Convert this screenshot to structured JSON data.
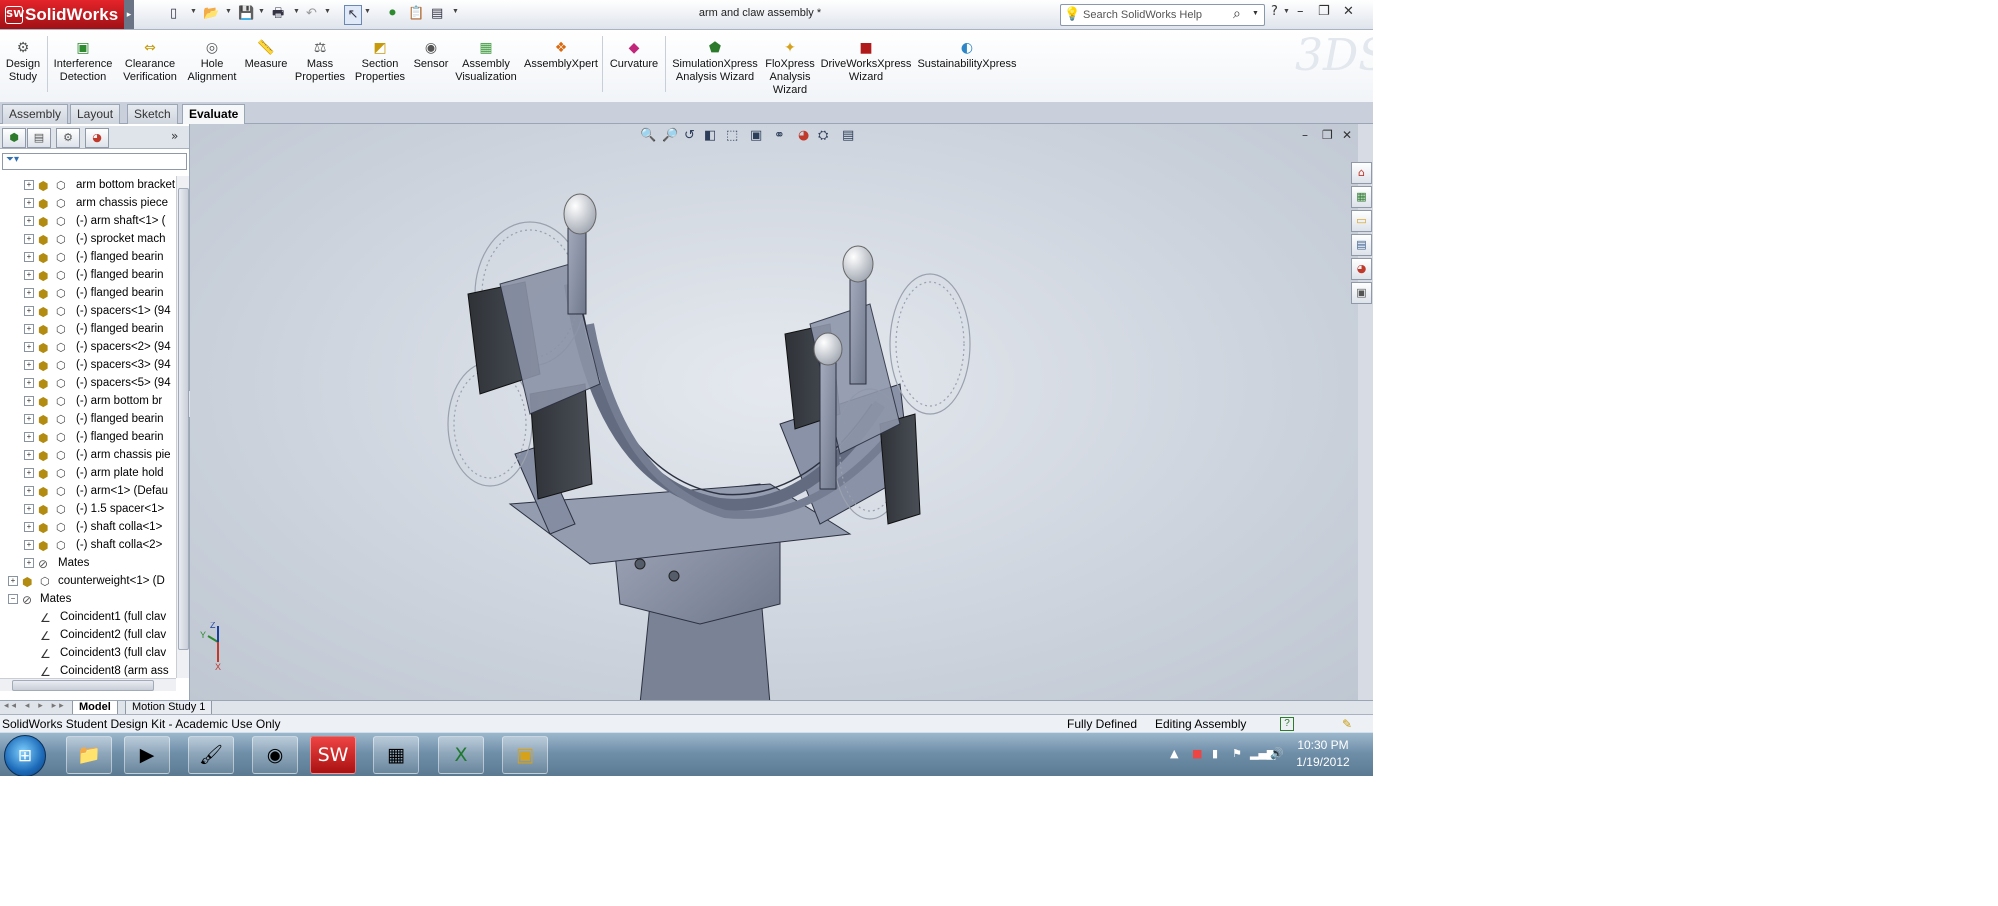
{
  "app": {
    "name": "SolidWorks",
    "doc_title": "arm and claw assembly *",
    "search_placeholder": "Search SolidWorks Help"
  },
  "commands": [
    {
      "label": "Design\nStudy",
      "icon": "design-study-icon"
    },
    {
      "label": "Interference\nDetection",
      "icon": "interference-detection-icon"
    },
    {
      "label": "Clearance\nVerification",
      "icon": "clearance-verification-icon"
    },
    {
      "label": "Hole\nAlignment",
      "icon": "hole-alignment-icon"
    },
    {
      "label": "Measure",
      "icon": "measure-icon"
    },
    {
      "label": "Mass\nProperties",
      "icon": "mass-properties-icon"
    },
    {
      "label": "Section\nProperties",
      "icon": "section-properties-icon"
    },
    {
      "label": "Sensor",
      "icon": "sensor-icon"
    },
    {
      "label": "Assembly\nVisualization",
      "icon": "assembly-visualization-icon"
    },
    {
      "label": "AssemblyXpert",
      "icon": "assemblyxpert-icon"
    },
    {
      "label": "Curvature",
      "icon": "curvature-icon"
    },
    {
      "label": "SimulationXpress\nAnalysis Wizard",
      "icon": "simulationxpress-icon"
    },
    {
      "label": "FloXpress\nAnalysis\nWizard",
      "icon": "floxpress-icon"
    },
    {
      "label": "DriveWorksXpress\nWizard",
      "icon": "driveworksxpress-icon"
    },
    {
      "label": "SustainabilityXpress",
      "icon": "sustainabilityxpress-icon"
    }
  ],
  "tabs": [
    {
      "label": "Assembly",
      "active": false
    },
    {
      "label": "Layout",
      "active": false
    },
    {
      "label": "Sketch",
      "active": false
    },
    {
      "label": "Evaluate",
      "active": true
    }
  ],
  "tree": [
    {
      "label": "arm bottom bracket",
      "type": "part"
    },
    {
      "label": "arm chassis piece",
      "type": "part"
    },
    {
      "label": "(-) arm shaft<1> (",
      "type": "part"
    },
    {
      "label": "(-) sprocket mach",
      "type": "part"
    },
    {
      "label": "(-) flanged bearin",
      "type": "part"
    },
    {
      "label": "(-) flanged bearin",
      "type": "part"
    },
    {
      "label": "(-) flanged bearin",
      "type": "part"
    },
    {
      "label": "(-) spacers<1> (94",
      "type": "part"
    },
    {
      "label": "(-) flanged bearin",
      "type": "part"
    },
    {
      "label": "(-) spacers<2> (94",
      "type": "part"
    },
    {
      "label": "(-) spacers<3> (94",
      "type": "part"
    },
    {
      "label": "(-) spacers<5> (94",
      "type": "part"
    },
    {
      "label": "(-) arm bottom br",
      "type": "part"
    },
    {
      "label": "(-) flanged bearin",
      "type": "part"
    },
    {
      "label": "(-) flanged bearin",
      "type": "part"
    },
    {
      "label": "(-) arm chassis pie",
      "type": "part"
    },
    {
      "label": "(-) arm plate hold",
      "type": "part"
    },
    {
      "label": "(-) arm<1> (Defau",
      "type": "part"
    },
    {
      "label": "(-) 1.5 spacer<1>",
      "type": "part"
    },
    {
      "label": "(-) shaft colla<1>",
      "type": "part"
    },
    {
      "label": "(-) shaft colla<2>",
      "type": "part"
    },
    {
      "label": "Mates",
      "type": "mates-sub"
    },
    {
      "label": "counterweight<1> (D",
      "type": "assembly"
    },
    {
      "label": "Mates",
      "type": "mates"
    },
    {
      "label": "Coincident1 (full clav",
      "type": "mate"
    },
    {
      "label": "Coincident2 (full clav",
      "type": "mate"
    },
    {
      "label": "Coincident3 (full clav",
      "type": "mate"
    },
    {
      "label": "Coincident8 (arm ass",
      "type": "mate"
    }
  ],
  "model_tabs": [
    {
      "label": "Model",
      "active": true
    },
    {
      "label": "Motion Study 1",
      "active": false
    }
  ],
  "status": {
    "left": "SolidWorks Student Design Kit - Academic Use Only",
    "state": "Fully Defined",
    "mode": "Editing Assembly"
  },
  "taskbar": {
    "apps": [
      "windows-explorer-icon",
      "media-player-icon",
      "paint-icon",
      "chrome-icon",
      "solidworks-icon",
      "calculator-icon",
      "excel-icon",
      "file-manager-icon"
    ],
    "time": "10:30 PM",
    "date": "1/19/2012"
  },
  "triad": {
    "y": "Y",
    "z": "Z",
    "x": "X"
  },
  "colors": {
    "brand": "#c8181e",
    "model": "#8b93a6",
    "viewport": "#d3d9e1"
  }
}
